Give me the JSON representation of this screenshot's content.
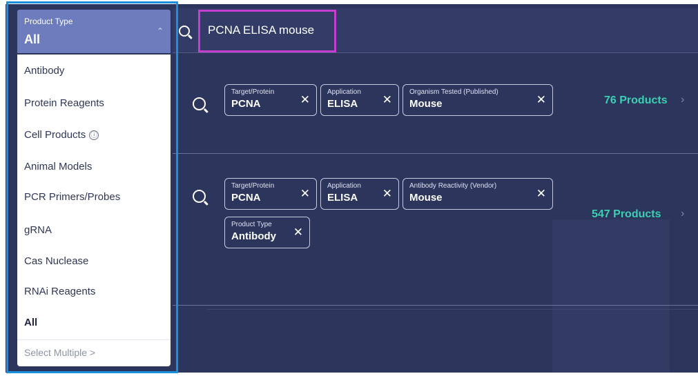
{
  "search": {
    "query": "PCNA ELISA mouse",
    "icon": "search-icon"
  },
  "dropdown": {
    "label": "Product Type",
    "value": "All",
    "caret_icon": "chevron-up-icon",
    "items": [
      {
        "label": "Antibody"
      },
      {
        "label": "Protein Reagents"
      },
      {
        "label": "Cell Products",
        "info_icon": "ⓘ"
      },
      {
        "label": "Animal Models"
      },
      {
        "label": "PCR Primers/Probes"
      },
      {
        "label": "gRNA"
      },
      {
        "label": "Cas Nuclease"
      },
      {
        "label": "RNAi Reagents"
      },
      {
        "label": "All"
      }
    ],
    "select_multiple": "Select Multiple >"
  },
  "suggestions": [
    {
      "chips": [
        {
          "label": "Target/Protein",
          "value": "PCNA"
        },
        {
          "label": "Application",
          "value": "ELISA"
        },
        {
          "label": "Organism Tested (Published)",
          "value": "Mouse"
        }
      ],
      "count": "76 Products"
    },
    {
      "chips": [
        {
          "label": "Target/Protein",
          "value": "PCNA"
        },
        {
          "label": "Application",
          "value": "ELISA"
        },
        {
          "label": "Antibody Reactivity (Vendor)",
          "value": "Mouse"
        },
        {
          "label": "Product Type",
          "value": "Antibody"
        }
      ],
      "count": "547 Products"
    }
  ],
  "symbols": {
    "close": "✕",
    "chevron_right": "›",
    "chevron_up": "⌃"
  },
  "colors": {
    "background": "#2c355c",
    "dropdown_header": "#6d7cbc",
    "count_text": "#3ccfb4",
    "highlight_query": "#c63ed0",
    "highlight_dropdown": "#1a8fdb"
  }
}
